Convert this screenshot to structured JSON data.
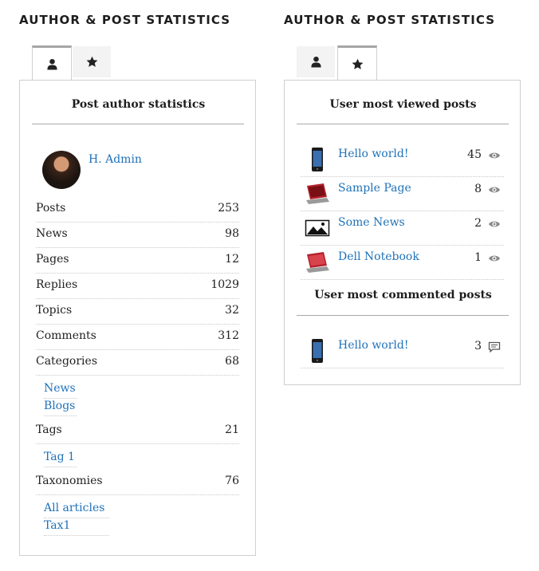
{
  "widgets": {
    "left": {
      "title": "AUTHOR & POST STATISTICS",
      "tabs": [
        {
          "icon": "user-icon",
          "active": true
        },
        {
          "icon": "star-icon",
          "active": false
        }
      ],
      "panel_title": "Post author statistics",
      "author": {
        "name": "H. Admin"
      },
      "stats": [
        {
          "label": "Posts",
          "value": "253"
        },
        {
          "label": "News",
          "value": "98"
        },
        {
          "label": "Pages",
          "value": "12"
        },
        {
          "label": "Replies",
          "value": "1029"
        },
        {
          "label": "Topics",
          "value": "32"
        },
        {
          "label": "Comments",
          "value": "312"
        },
        {
          "label": "Categories",
          "value": "68"
        },
        {
          "label": "Tags",
          "value": "21"
        },
        {
          "label": "Taxonomies",
          "value": "76"
        }
      ],
      "categories": [
        "News",
        "Blogs"
      ],
      "tags": [
        "Tag 1"
      ],
      "taxonomies": [
        "All articles",
        "Tax1"
      ]
    },
    "right": {
      "title": "AUTHOR & POST STATISTICS",
      "tabs": [
        {
          "icon": "user-icon",
          "active": false
        },
        {
          "icon": "star-icon",
          "active": true
        }
      ],
      "viewed_title": "User most viewed posts",
      "viewed": [
        {
          "title": "Hello world!",
          "count": "45",
          "thumb": "phone-thumbnail"
        },
        {
          "title": "Sample Page",
          "count": "8",
          "thumb": "laptop-thumbnail"
        },
        {
          "title": "Some News",
          "count": "2",
          "thumb": "image-placeholder-thumbnail"
        },
        {
          "title": "Dell Notebook",
          "count": "1",
          "thumb": "laptop-thumbnail"
        }
      ],
      "commented_title": "User most commented posts",
      "commented": [
        {
          "title": "Hello world!",
          "count": "3",
          "thumb": "phone-thumbnail"
        }
      ]
    }
  },
  "colors": {
    "link": "#1f72b8",
    "border": "#cfcfcf",
    "tab_bg": "#f3f3f3"
  }
}
